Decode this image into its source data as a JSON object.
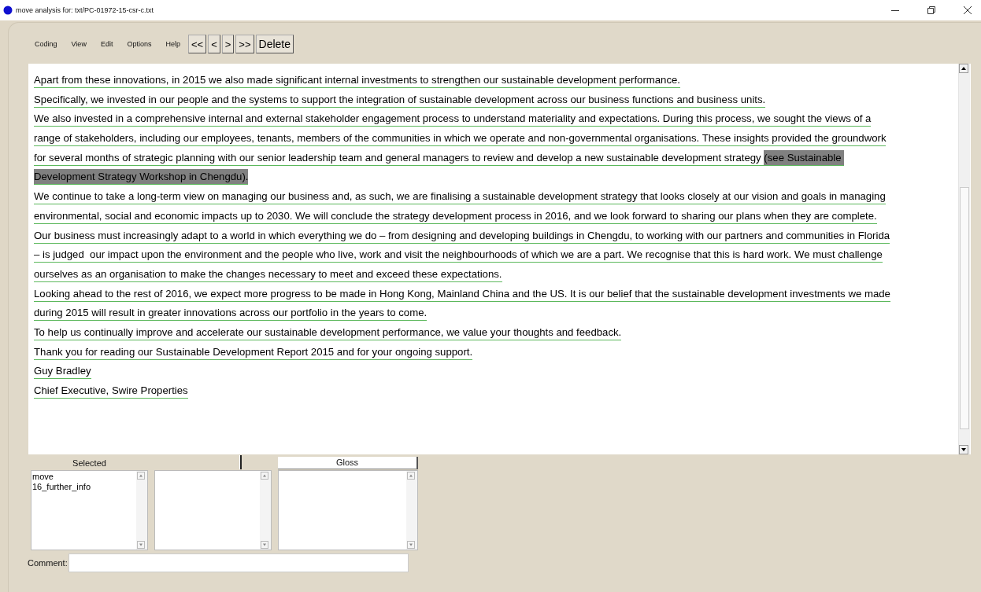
{
  "window": {
    "title": "move analysis for: txt/PC-01972-15-csr-c.txt"
  },
  "menu": [
    "Coding",
    "View",
    "Edit",
    "Options",
    "Help"
  ],
  "nav_buttons": [
    "<<",
    "<",
    ">",
    ">>",
    "Delete"
  ],
  "text_lines": [
    {
      "segments": [
        {
          "text": "Apart from these innovations, in 2015 we also made significant internal investments to strengthen our sustainable development performance.",
          "highlighted": false
        }
      ]
    },
    {
      "segments": [
        {
          "text": "Specifically, we invested in our people and the systems to support the integration of sustainable development across our business functions and business units.",
          "highlighted": false
        }
      ]
    },
    {
      "segments": [
        {
          "text": "We also invested in a comprehensive internal and external stakeholder engagement process to understand materiality and expectations. During this process, we sought the views of a",
          "highlighted": false
        }
      ]
    },
    {
      "segments": [
        {
          "text": "range of stakeholders, including our employees, tenants, members of the communities in which we operate and non-governmental organisations. These insights provided the groundwork",
          "highlighted": false
        }
      ]
    },
    {
      "segments": [
        {
          "text": "for several months of strategic planning with our senior leadership team and general managers to review and develop a new sustainable development strategy ",
          "highlighted": false
        },
        {
          "text": "(see Sustainable ",
          "highlighted": true
        }
      ]
    },
    {
      "segments": [
        {
          "text": "Development Strategy Workshop in Chengdu).",
          "highlighted": true
        }
      ]
    },
    {
      "segments": [
        {
          "text": "We continue to take a long-term view on managing our business and, as such, we are finalising a sustainable development strategy that looks closely at our vision and goals in managing",
          "highlighted": false
        }
      ]
    },
    {
      "segments": [
        {
          "text": "environmental, social and economic impacts up to 2030. We will conclude the strategy development process in 2016, and we look forward to sharing our plans when they are complete.",
          "highlighted": false
        }
      ]
    },
    {
      "segments": [
        {
          "text": "Our business must increasingly adapt to a world in which everything we do – from designing and developing buildings in Chengdu, to working with our partners and communities in Florida",
          "highlighted": false
        }
      ]
    },
    {
      "segments": [
        {
          "text": "– is judged  our impact upon the environment and the people who live, work and visit the neighbourhoods of which we are a part. We recognise that this is hard work. We must challenge",
          "highlighted": false
        }
      ]
    },
    {
      "segments": [
        {
          "text": "ourselves as an organisation to make the changes necessary to meet and exceed these expectations.",
          "highlighted": false
        }
      ]
    },
    {
      "segments": [
        {
          "text": "Looking ahead to the rest of 2016, we expect more progress to be made in Hong Kong, Mainland China and the US. It is our belief that the sustainable development investments we made",
          "highlighted": false
        }
      ]
    },
    {
      "segments": [
        {
          "text": "during 2015 will result in greater innovations across our portfolio in the years to come.",
          "highlighted": false
        }
      ]
    },
    {
      "segments": [
        {
          "text": "To help us continually improve and accelerate our sustainable development performance, we value your thoughts and feedback.",
          "highlighted": false
        }
      ]
    },
    {
      "segments": [
        {
          "text": "Thank you for reading our Sustainable Development Report 2015 and for your ongoing support.",
          "highlighted": false
        }
      ]
    },
    {
      "segments": [
        {
          "text": "Guy Bradley",
          "highlighted": false
        }
      ]
    },
    {
      "segments": [
        {
          "text": "Chief Executive, Swire Properties",
          "highlighted": false
        }
      ]
    }
  ],
  "panels": [
    {
      "kind": "label",
      "header": "Selected",
      "items": [
        "move",
        "16_further_info"
      ]
    },
    {
      "kind": "handle"
    },
    {
      "kind": "button",
      "header": "Gloss"
    }
  ],
  "comment": {
    "label": "Comment:"
  }
}
